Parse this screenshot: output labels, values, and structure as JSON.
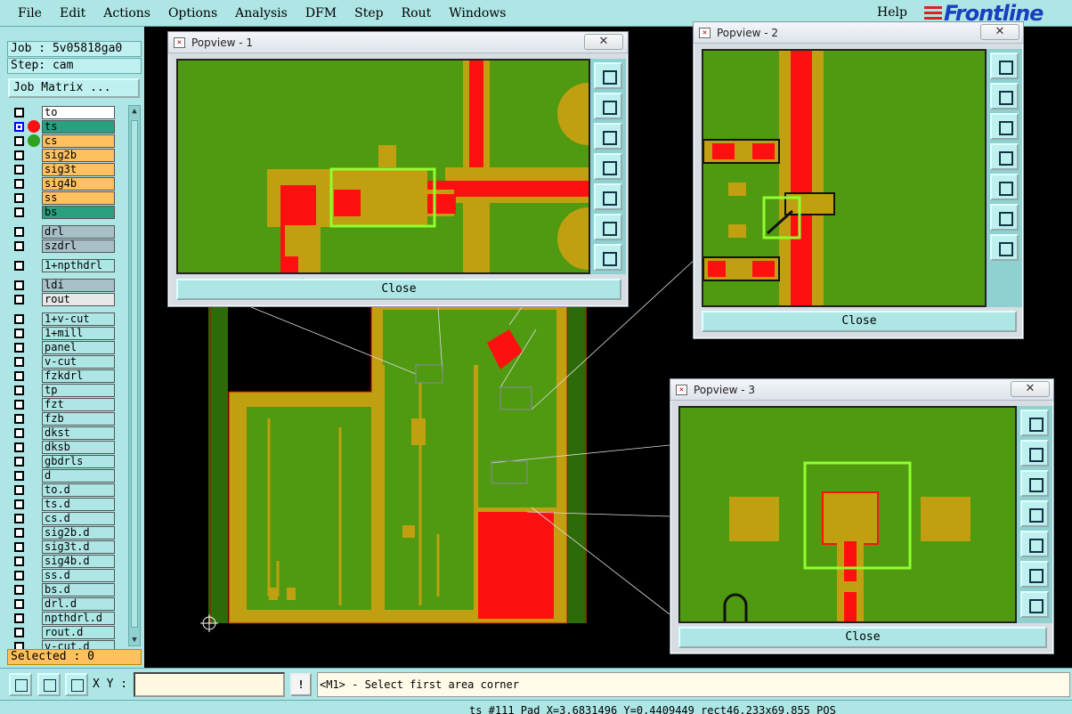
{
  "menu": {
    "items": [
      "File",
      "Edit",
      "Actions",
      "Options",
      "Analysis",
      "DFM",
      "Step",
      "Rout",
      "Windows"
    ],
    "help": "Help",
    "brand": "Frontline"
  },
  "job": {
    "job_line": "Job : 5v05818ga0",
    "step_line": "Step: cam",
    "matrix_button": "Job Matrix ..."
  },
  "layers": [
    {
      "name": "to",
      "color": "#ffffff",
      "dot": "",
      "checked": false
    },
    {
      "name": "ts",
      "color": "#2aa080",
      "dot": "#ff1010",
      "checked": true
    },
    {
      "name": "cs",
      "color": "#ffc060",
      "dot": "#30a020",
      "checked": false
    },
    {
      "name": "sig2b",
      "color": "#ffc060",
      "dot": "",
      "checked": false
    },
    {
      "name": "sig3t",
      "color": "#ffc060",
      "dot": "",
      "checked": false
    },
    {
      "name": "sig4b",
      "color": "#ffc060",
      "dot": "",
      "checked": false
    },
    {
      "name": "ss",
      "color": "#ffc060",
      "dot": "",
      "checked": false
    },
    {
      "name": "bs",
      "color": "#2aa080",
      "dot": "",
      "checked": false
    },
    {
      "gap": true
    },
    {
      "name": "drl",
      "color": "#a8bfc8",
      "dot": "",
      "checked": false
    },
    {
      "name": "szdrl",
      "color": "#a8bfc8",
      "dot": "",
      "checked": false
    },
    {
      "gap": true
    },
    {
      "name": "1+npthdrl",
      "color": "#aee6e6",
      "dot": "",
      "checked": false
    },
    {
      "gap": true
    },
    {
      "name": "ldi",
      "color": "#a8bfc8",
      "dot": "",
      "checked": false
    },
    {
      "name": "rout",
      "color": "#e8e8e8",
      "dot": "",
      "checked": false
    },
    {
      "gap": true
    },
    {
      "name": "1+v-cut",
      "color": "#aee6e6",
      "dot": "",
      "checked": false
    },
    {
      "name": "1+mill",
      "color": "#aee6e6",
      "dot": "",
      "checked": false
    },
    {
      "name": "panel",
      "color": "#aee6e6",
      "dot": "",
      "checked": false
    },
    {
      "name": "v-cut",
      "color": "#aee6e6",
      "dot": "",
      "checked": false
    },
    {
      "name": "fzkdrl",
      "color": "#aee6e6",
      "dot": "",
      "checked": false
    },
    {
      "name": "tp",
      "color": "#aee6e6",
      "dot": "",
      "checked": false
    },
    {
      "name": "fzt",
      "color": "#aee6e6",
      "dot": "",
      "checked": false
    },
    {
      "name": "fzb",
      "color": "#aee6e6",
      "dot": "",
      "checked": false
    },
    {
      "name": "dkst",
      "color": "#aee6e6",
      "dot": "",
      "checked": false
    },
    {
      "name": "dksb",
      "color": "#aee6e6",
      "dot": "",
      "checked": false
    },
    {
      "name": "gbdrls",
      "color": "#aee6e6",
      "dot": "",
      "checked": false
    },
    {
      "name": "d",
      "color": "#aee6e6",
      "dot": "",
      "checked": false
    },
    {
      "name": "to.d",
      "color": "#aee6e6",
      "dot": "",
      "checked": false
    },
    {
      "name": "ts.d",
      "color": "#aee6e6",
      "dot": "",
      "checked": false
    },
    {
      "name": "cs.d",
      "color": "#aee6e6",
      "dot": "",
      "checked": false
    },
    {
      "name": "sig2b.d",
      "color": "#aee6e6",
      "dot": "",
      "checked": false
    },
    {
      "name": "sig3t.d",
      "color": "#aee6e6",
      "dot": "",
      "checked": false
    },
    {
      "name": "sig4b.d",
      "color": "#aee6e6",
      "dot": "",
      "checked": false
    },
    {
      "name": "ss.d",
      "color": "#aee6e6",
      "dot": "",
      "checked": false
    },
    {
      "name": "bs.d",
      "color": "#aee6e6",
      "dot": "",
      "checked": false
    },
    {
      "name": "drl.d",
      "color": "#aee6e6",
      "dot": "",
      "checked": false
    },
    {
      "name": "npthdrl.d",
      "color": "#aee6e6",
      "dot": "",
      "checked": false
    },
    {
      "name": "rout.d",
      "color": "#aee6e6",
      "dot": "",
      "checked": false
    },
    {
      "name": "v-cut.d",
      "color": "#aee6e6",
      "dot": "",
      "checked": false
    }
  ],
  "selected": "Selected : 0",
  "popups": [
    {
      "title": "Popview - 1",
      "close_label": "Close",
      "x_label": "✕"
    },
    {
      "title": "Popview - 2",
      "close_label": "Close",
      "x_label": "✕"
    },
    {
      "title": "Popview - 3",
      "close_label": "Close",
      "x_label": "✕"
    }
  ],
  "bottom": {
    "xy_label": "X Y :",
    "xy_value": "",
    "warn": "!",
    "prompt": "<M1> - Select first area corner"
  },
  "status": "ts #111 Pad X=3.6831496 Y=0.4409449 rect46.233x69.855 POS",
  "colors": {
    "ui_bg": "#aee6e6",
    "copper_green": "#4f9a10",
    "pad_gold": "#c0a010",
    "mask_red": "#ff1010",
    "highlight": "#90ff30"
  }
}
